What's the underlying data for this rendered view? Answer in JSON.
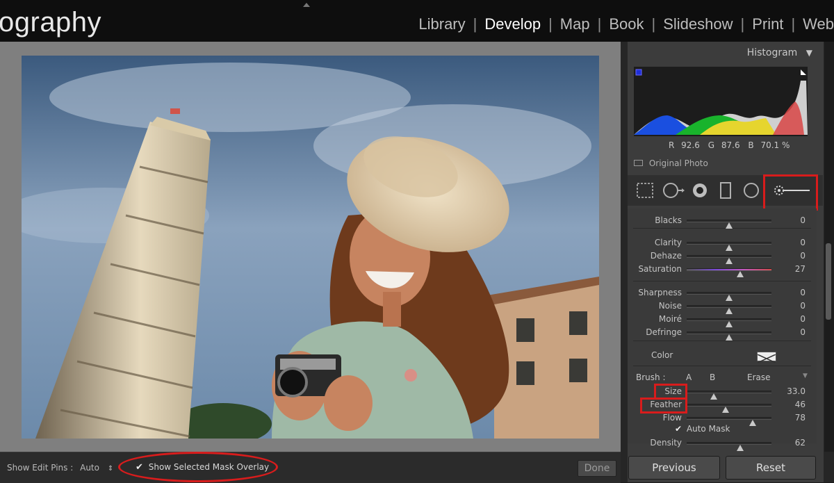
{
  "header": {
    "brand": "ography",
    "modules": [
      {
        "label": "Library",
        "active": false
      },
      {
        "label": "Develop",
        "active": true
      },
      {
        "label": "Map",
        "active": false
      },
      {
        "label": "Book",
        "active": false
      },
      {
        "label": "Slideshow",
        "active": false
      },
      {
        "label": "Print",
        "active": false
      },
      {
        "label": "Web",
        "active": false
      }
    ],
    "separator": "|"
  },
  "toolbar": {
    "show_edit_pins_label": "Show Edit Pins :",
    "show_edit_pins_value": "Auto",
    "show_mask_overlay_label": "Show Selected Mask Overlay",
    "done_label": "Done"
  },
  "histogram": {
    "title": "Histogram",
    "r_label": "R",
    "r_value": "92.6",
    "g_label": "G",
    "g_value": "87.6",
    "b_label": "B",
    "b_value": "70.1 %",
    "original_photo_label": "Original Photo"
  },
  "sliders": [
    {
      "label": "Blacks",
      "value": "0",
      "pos": 0.5,
      "group": 0
    },
    {
      "label": "Clarity",
      "value": "0",
      "pos": 0.5,
      "group": 1
    },
    {
      "label": "Dehaze",
      "value": "0",
      "pos": 0.5,
      "group": 1
    },
    {
      "label": "Saturation",
      "value": "27",
      "pos": 0.63,
      "group": 1
    },
    {
      "label": "Sharpness",
      "value": "0",
      "pos": 0.5,
      "group": 2
    },
    {
      "label": "Noise",
      "value": "0",
      "pos": 0.5,
      "group": 2
    },
    {
      "label": "Moiré",
      "value": "0",
      "pos": 0.5,
      "group": 2
    },
    {
      "label": "Defringe",
      "value": "0",
      "pos": 0.5,
      "group": 2
    }
  ],
  "color_label": "Color",
  "brush": {
    "label": "Brush :",
    "a": "A",
    "b": "B",
    "erase": "Erase",
    "size_label": "Size",
    "size_value": "33.0",
    "feather_label": "Feather",
    "feather_value": "46",
    "flow_label": "Flow",
    "flow_value": "78",
    "automask_label": "Auto Mask",
    "density_label": "Density",
    "density_value": "62"
  },
  "buttons": {
    "previous": "Previous",
    "reset": "Reset"
  },
  "colors": {
    "highlight": "#d81c1c",
    "topbar": "#0e0e0e",
    "panel": "#3a3a3a"
  }
}
